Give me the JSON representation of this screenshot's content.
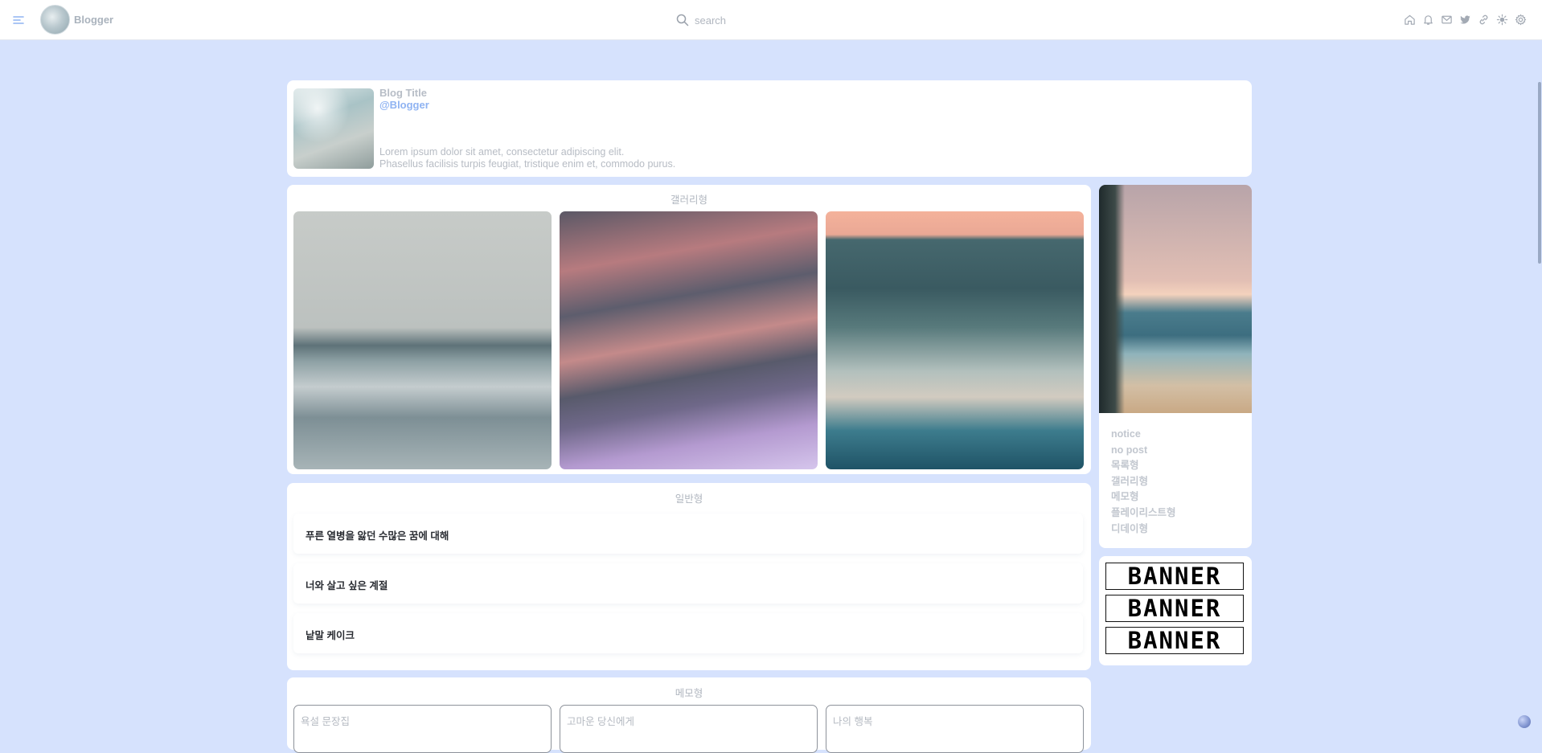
{
  "header": {
    "brand": "Blogger",
    "search_placeholder": "search",
    "icons": [
      "home-icon",
      "bell-icon",
      "mail-icon",
      "twitter-icon",
      "link-icon",
      "sun-icon",
      "gear-icon"
    ]
  },
  "profile": {
    "title": "Blog Title",
    "handle": "@Blogger",
    "description": [
      "Lorem ipsum dolor sit amet, consectetur adipiscing elit.",
      "Phasellus facilisis turpis feugiat, tristique enim et, commodo purus."
    ]
  },
  "gallery": {
    "title": "갤러리형"
  },
  "posts": {
    "title": "일반형",
    "items": [
      "푸른 열병을 앓던 수많은 꿈에 대해",
      "너와 살고 싶은 계절",
      "낱말 케이크"
    ]
  },
  "memo": {
    "title": "메모형",
    "items": [
      "욕설 문장집",
      "고마운 당신에게",
      "나의 행복"
    ]
  },
  "notice": {
    "links": [
      "notice",
      "no post",
      "목록형",
      "갤러리형",
      "메모형",
      "플레이리스트형",
      "디데이형"
    ]
  },
  "banners": [
    "BANNER",
    "BANNER",
    "BANNER"
  ],
  "colors": {
    "background": "#d6e2fd",
    "accent": "#8fb3f2"
  }
}
